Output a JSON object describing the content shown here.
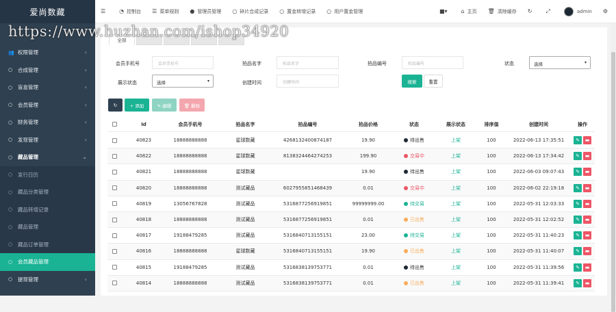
{
  "brand": "爱尚数藏",
  "topbar": {
    "items": [
      {
        "icon": "menu-icon",
        "glyph": "☰",
        "label": ""
      },
      {
        "icon": "dashboard-icon",
        "glyph": "◔",
        "label": "控制台"
      },
      {
        "icon": "menu-rule-icon",
        "glyph": "☰",
        "label": "菜单规则"
      },
      {
        "icon": "admin-user-icon",
        "glyph": "●",
        "label": "管理员管理"
      },
      {
        "icon": "circle-icon",
        "glyph": "○",
        "label": "碎片合成记录"
      },
      {
        "icon": "circle-icon",
        "glyph": "○",
        "label": "置金转增记录"
      },
      {
        "icon": "circle-icon",
        "glyph": "○",
        "label": "用户置金管理"
      }
    ],
    "right": [
      {
        "icon": "theme-icon",
        "glyph": "■▾",
        "label": ""
      },
      {
        "icon": "home-icon",
        "glyph": "⌂",
        "label": "主页"
      },
      {
        "icon": "trash-icon",
        "glyph": "🗑",
        "label": "清除缓存"
      },
      {
        "icon": "refresh-icon",
        "glyph": "↻",
        "label": ""
      },
      {
        "icon": "fullscreen-icon",
        "glyph": "⤢",
        "label": ""
      }
    ],
    "user": "admin",
    "settings_glyph": "⚙"
  },
  "watermark": "https://www.huzhan.com/ishop34920",
  "sidebar": {
    "items": [
      {
        "label": "权限管理",
        "icon": "users-icon",
        "glyph": "👥",
        "caret": "‹",
        "type": "top"
      },
      {
        "label": "合成管理",
        "icon": "circle-icon",
        "glyph": "○",
        "caret": "‹",
        "type": "top"
      },
      {
        "label": "盲盒管理",
        "icon": "circle-icon",
        "glyph": "○",
        "caret": "‹",
        "type": "top"
      },
      {
        "label": "会员管理",
        "icon": "circle-icon",
        "glyph": "○",
        "caret": "‹",
        "type": "top"
      },
      {
        "label": "财务管理",
        "icon": "circle-icon",
        "glyph": "○",
        "caret": "‹",
        "type": "top"
      },
      {
        "label": "发现管理",
        "icon": "circle-icon",
        "glyph": "○",
        "caret": "‹",
        "type": "top"
      },
      {
        "label": "藏品管理",
        "icon": "circle-icon",
        "glyph": "○",
        "caret": "⌄",
        "type": "open"
      },
      {
        "label": "发行日历",
        "icon": "circle-icon",
        "glyph": "○",
        "caret": "",
        "type": "sub"
      },
      {
        "label": "藏品分类管理",
        "icon": "circle-icon",
        "glyph": "○",
        "caret": "",
        "type": "sub"
      },
      {
        "label": "藏品转增记录",
        "icon": "circle-icon",
        "glyph": "○",
        "caret": "",
        "type": "sub"
      },
      {
        "label": "藏品管理",
        "icon": "circle-icon",
        "glyph": "○",
        "caret": "",
        "type": "sub"
      },
      {
        "label": "藏品订单管理",
        "icon": "circle-icon",
        "glyph": "○",
        "caret": "",
        "type": "sub"
      },
      {
        "label": "会员藏品管理",
        "icon": "circle-icon",
        "glyph": "○",
        "caret": "",
        "type": "sub-active"
      },
      {
        "label": "提现管理",
        "icon": "circle-icon",
        "glyph": "○",
        "caret": "‹",
        "type": "top"
      }
    ]
  },
  "tabs": [
    "全部",
    "",
    "",
    "",
    ""
  ],
  "filters": {
    "phone_label": "会员手机号",
    "phone_placeholder": "会员手机号",
    "name_label": "拍品名字",
    "name_placeholder": "拍品名字",
    "number_label": "拍品编号",
    "number_placeholder": "拍品编号",
    "status_label": "状态",
    "status_value": "选择",
    "display_label": "展示状态",
    "display_value": "选择",
    "created_label": "创建时间",
    "created_placeholder": "创建时间",
    "search_btn": "搜索",
    "reset_btn": "重置"
  },
  "toolbar": {
    "refresh_glyph": "↻",
    "add_label": "+ 添加",
    "edit_label": "✎ 编辑",
    "delete_label": "🗑 删除"
  },
  "table": {
    "headers": [
      "Id",
      "会员手机号",
      "拍品名字",
      "拍品编号",
      "拍品价格",
      "状态",
      "展示状态",
      "排序值",
      "创建时间",
      "操作"
    ],
    "rows": [
      {
        "id": "40823",
        "phone": "18888888888",
        "name": "星球数藏",
        "number": "4268132400874187",
        "price": "19.90",
        "status": "待出售",
        "status_color": "#1c2833",
        "display": "上架",
        "sort": "100",
        "time": "2022-06-13 17:35:51"
      },
      {
        "id": "40822",
        "phone": "18888888888",
        "name": "星球数藏",
        "number": "8138324464274253",
        "price": "199.90",
        "status": "交易中",
        "status_color": "#ed5565",
        "display": "上架",
        "sort": "100",
        "time": "2022-06-13 17:34:42"
      },
      {
        "id": "40821",
        "phone": "18888888888",
        "name": "星球数藏",
        "number": "",
        "price": "19.90",
        "status": "待出售",
        "status_color": "#1c2833",
        "display": "上架",
        "sort": "100",
        "time": "2022-06-03 09:07:43"
      },
      {
        "id": "40820",
        "phone": "18888888888",
        "name": "测试藏品",
        "number": "6027955851468439",
        "price": "0.01",
        "status": "交易中",
        "status_color": "#ed5565",
        "display": "上架",
        "sort": "100",
        "time": "2022-06-02 22:19:18"
      },
      {
        "id": "40819",
        "phone": "13056767828",
        "name": "测试藏品",
        "number": "5316877256919851",
        "price": "99999999.00",
        "status": "待交易",
        "status_color": "#1ab394",
        "display": "上架",
        "sort": "100",
        "time": "2022-05-31 12:03:33"
      },
      {
        "id": "40818",
        "phone": "18888888888",
        "name": "测试藏品",
        "number": "5316877256919851",
        "price": "0.01",
        "status": "已出售",
        "status_color": "#f8ac59",
        "display": "上架",
        "sort": "100",
        "time": "2022-05-31 12:02:52"
      },
      {
        "id": "40817",
        "phone": "19188479285",
        "name": "测试藏品",
        "number": "5316840713155151",
        "price": "23.00",
        "status": "待交易",
        "status_color": "#1ab394",
        "display": "上架",
        "sort": "100",
        "time": "2022-05-31 11:40:23"
      },
      {
        "id": "40816",
        "phone": "18888888888",
        "name": "星球数藏",
        "number": "5316840713155151",
        "price": "19.90",
        "status": "已出售",
        "status_color": "#f8ac59",
        "display": "上架",
        "sort": "100",
        "time": "2022-05-31 11:40:07"
      },
      {
        "id": "40815",
        "phone": "19188479285",
        "name": "测试藏品",
        "number": "5316838139753771",
        "price": "0.01",
        "status": "待出售",
        "status_color": "#1c2833",
        "display": "上架",
        "sort": "100",
        "time": "2022-05-31 11:39:56"
      },
      {
        "id": "40814",
        "phone": "18888888888",
        "name": "测试藏品",
        "number": "5316838139753771",
        "price": "0.01",
        "status": "已出售",
        "status_color": "#f8ac59",
        "display": "上架",
        "sort": "100",
        "time": "2022-05-31 11:39:41"
      }
    ]
  },
  "colors": {
    "primary": "#1ab394",
    "danger": "#ed5565",
    "sidebar": "#2f4050",
    "dark_btn": "#2f4050"
  }
}
